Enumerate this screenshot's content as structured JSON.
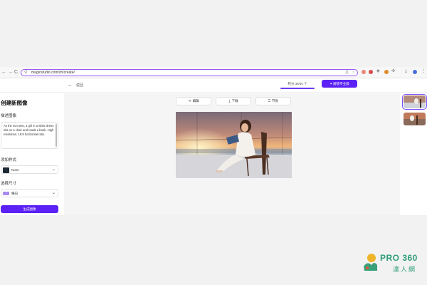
{
  "browser": {
    "url": "magicstudio.com/zh/create/",
    "nav_back": "←",
    "nav_forward": "→",
    "nav_reload": "C",
    "lock_symbol": "⚲"
  },
  "header": {
    "back_symbol": "←",
    "back_label": "返回",
    "credits_text": "积分 38/40 个",
    "upgrade_label": "✦ 解锁专业版"
  },
  "sidebar": {
    "title": "创建新图像",
    "describe_label": "描述图像",
    "prompt_text": "As the sun sets, a girl in a white dress sits on a chair and reads a book. High resolution, 16:9 horizontal ratio.",
    "style_label": "添加样式",
    "style_value": "None",
    "size_label": "选择尺寸",
    "size_value": "横向",
    "generate_label": "生成图像",
    "chevron": "⌄"
  },
  "toolbar": {
    "edit_label": "编辑",
    "edit_icon": "share-icon",
    "download_label": "下载",
    "download_icon": "download-icon",
    "save_label": "节省",
    "save_icon": "bookmark-icon"
  },
  "watermark": {
    "brand": "PRO 360",
    "subtitle": "達人網"
  },
  "colors": {
    "accent": "#5b21f5",
    "url_outline": "#9b59f5",
    "watermark": "#2f9e7b"
  }
}
